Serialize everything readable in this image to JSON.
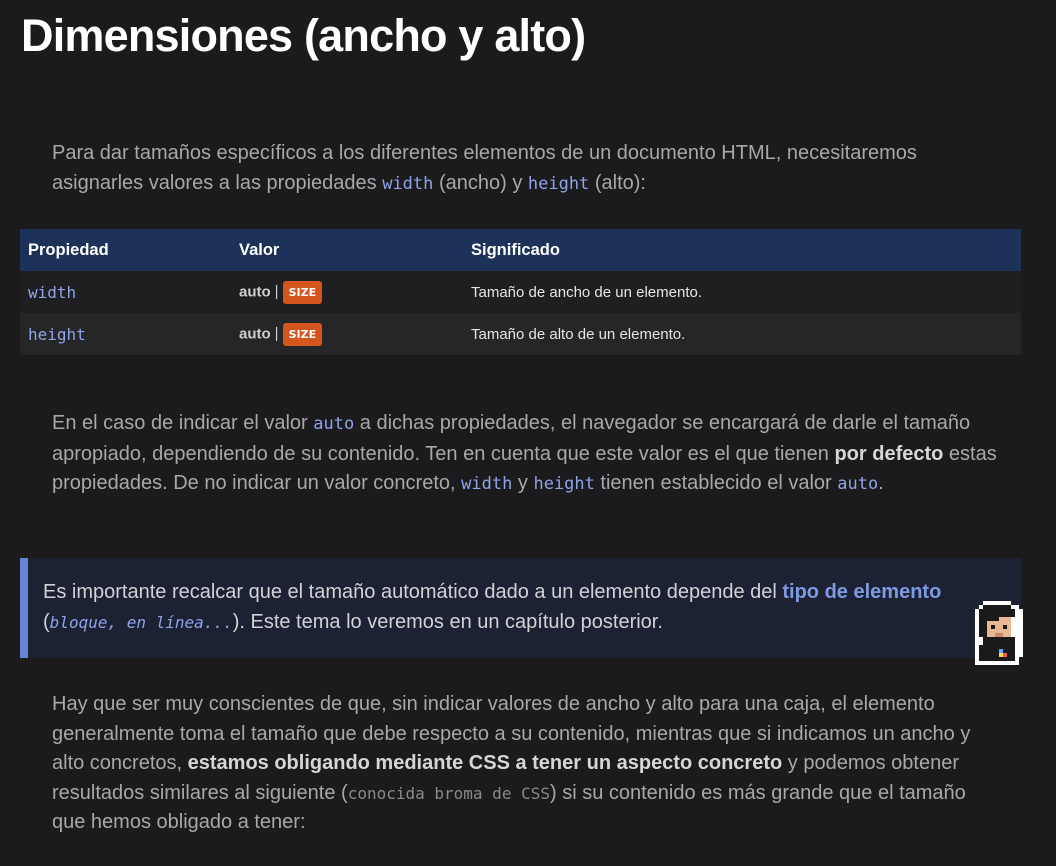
{
  "title": "Dimensiones (ancho y alto)",
  "intro": {
    "pre": "Para dar tamaños específicos a los diferentes elementos de un documento HTML, necesitaremos asignarles valores a las propiedades ",
    "code1": "width",
    "mid1": " (ancho) y ",
    "code2": "height",
    "post": " (alto):"
  },
  "table": {
    "headers": [
      "Propiedad",
      "Valor",
      "Significado"
    ],
    "rows": [
      {
        "prop": "width",
        "value_auto": "auto",
        "sep": "|",
        "badge": "SIZE",
        "meaning": "Tamaño de ancho de un elemento."
      },
      {
        "prop": "height",
        "value_auto": "auto",
        "sep": "|",
        "badge": "SIZE",
        "meaning": "Tamaño de alto de un elemento."
      }
    ]
  },
  "para2": {
    "t1": "En el caso de indicar el valor ",
    "c1": "auto",
    "t2": " a dichas propiedades, el navegador se encargará de darle el tamaño apropiado, dependiendo de su contenido. Ten en cuenta que este valor es el que tienen ",
    "b1": "por defecto",
    "t3": " estas propiedades. De no indicar un valor concreto, ",
    "c2": "width",
    "t4": " y ",
    "c3": "height",
    "t5": " tienen establecido el valor ",
    "c4": "auto",
    "t6": "."
  },
  "note": {
    "t1": "Es importante recalcar que el tamaño automático dado a un elemento depende del ",
    "b1": "tipo de elemento",
    "t2": " (",
    "c1": "bloque, en línea...",
    "t3": "). Este tema lo veremos en un capítulo posterior."
  },
  "para3": {
    "t1": "Hay que ser muy conscientes de que, sin indicar valores de ancho y alto para una caja, el elemento generalmente toma el tamaño que debe respecto a su contenido, mientras que si indicamos un ancho y alto concretos, ",
    "b1": "estamos obligando mediante CSS a tener un aspecto concreto",
    "t2": " y podemos obtener resultados similares al siguiente (",
    "c1": "conocida broma de CSS",
    "t3": ") si su contenido es más grande que el tamaño que hemos obligado a tener:"
  },
  "colors": {
    "accent": "#6784d4",
    "header": "#1c3258",
    "badge": "#d2561d",
    "code": "#8fa3e6"
  }
}
